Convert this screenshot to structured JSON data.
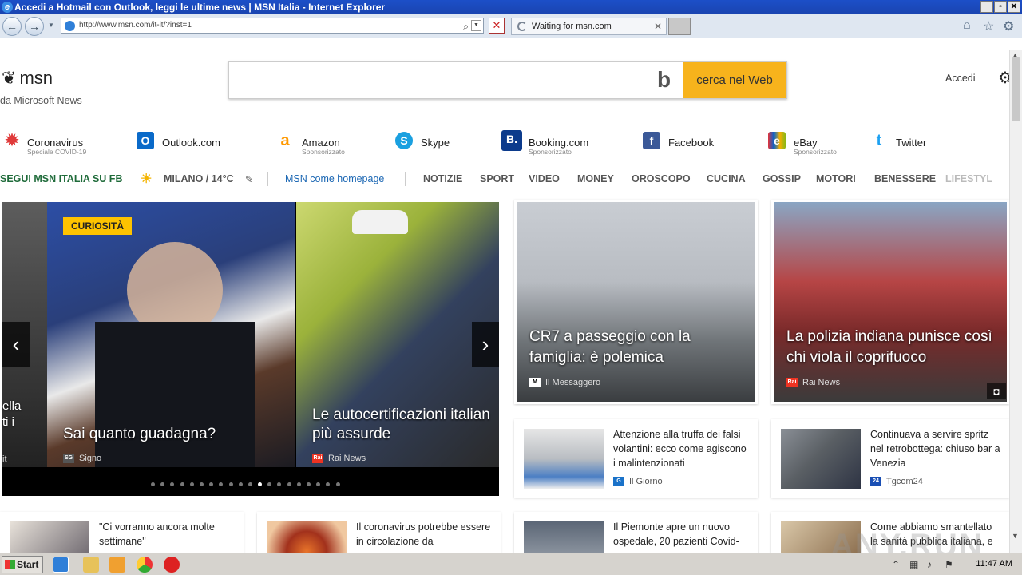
{
  "window": {
    "title": "Accedi a Hotmail con Outlook, leggi le ultime news | MSN Italia - Internet Explorer",
    "controls": [
      "_",
      "▫",
      "✕"
    ]
  },
  "browser": {
    "url": "http://www.msn.com/it-it/?inst=1",
    "tab_label": "Waiting for msn.com"
  },
  "header": {
    "logo_text": "msn",
    "logo_sub": "da Microsoft News",
    "search_placeholder": "",
    "search_button": "cerca nel Web",
    "signin": "Accedi"
  },
  "quicklinks": [
    {
      "label": "Coronavirus",
      "sub": "Speciale COVID-19",
      "icon": "virus-icon",
      "color": "#e03a3a",
      "glyph": "✹"
    },
    {
      "label": "Outlook.com",
      "sub": "",
      "icon": "outlook-icon",
      "color": "#0a6ac9",
      "glyph": "O"
    },
    {
      "label": "Amazon",
      "sub": "Sponsorizzato",
      "icon": "amazon-icon",
      "color": "#ff9900",
      "glyph": "a"
    },
    {
      "label": "Skype",
      "sub": "",
      "icon": "skype-icon",
      "color": "#1aa0e0",
      "glyph": "S"
    },
    {
      "label": "Booking.com",
      "sub": "Sponsorizzato",
      "icon": "booking-icon",
      "color": "#0c3b8c",
      "glyph": "B."
    },
    {
      "label": "Facebook",
      "sub": "",
      "icon": "facebook-icon",
      "color": "#3b5998",
      "glyph": "f"
    },
    {
      "label": "eBay",
      "sub": "Sponsorizzato",
      "icon": "ebay-icon",
      "color": "#e53238",
      "glyph": "e"
    },
    {
      "label": "Twitter",
      "sub": "",
      "icon": "twitter-icon",
      "color": "#1da1f2",
      "glyph": "t"
    }
  ],
  "navbar": {
    "follow_fb": "SEGUI MSN ITALIA SU FB",
    "weather": "MILANO / 14°C",
    "homepage_link": "MSN come homepage",
    "items": [
      "NOTIZIE",
      "SPORT",
      "VIDEO",
      "MONEY",
      "OROSCOPO",
      "CUCINA",
      "GOSSIP",
      "MOTORI",
      "BENESSERE",
      "LIFESTYL"
    ]
  },
  "hero": {
    "badge": "CURIOSITÀ",
    "left_fragment": "ella\nti i",
    "left_fragment_src": "it",
    "main_title": "Sai quanto guadagna?",
    "main_source": "Signo",
    "second_title": "Le autocertificazioni italian più assurde",
    "second_source": "Rai News",
    "dots_count": 20,
    "active_dot": 11
  },
  "big_cards": [
    {
      "title": "CR7 a passeggio con la famiglia: è polemica",
      "source": "Il Messaggero"
    },
    {
      "title": "La polizia indiana punisce così chi viola il coprifuoco",
      "source": "Rai News"
    }
  ],
  "small_cards": [
    {
      "title": "Attenzione alla truffa dei falsi volantini: ecco come agiscono i malintenzionati",
      "source": "Il Giorno"
    },
    {
      "title": "Continuava a servire spritz nel retrobottega: chiuso bar a Venezia",
      "source": "Tgcom24"
    },
    {
      "title": "\"Ci vorranno ancora molte settimane\"",
      "source": ""
    },
    {
      "title": "Il coronavirus potrebbe essere in circolazione da",
      "source": ""
    },
    {
      "title": "Il Piemonte apre un nuovo ospedale, 20 pazienti Covid-",
      "source": ""
    },
    {
      "title": "Come abbiamo smantellato la sanità pubblica italiana, e",
      "source": ""
    }
  ],
  "taskbar": {
    "start": "Start",
    "clock": "11:47 AM"
  },
  "watermark": "ANY.RUN"
}
